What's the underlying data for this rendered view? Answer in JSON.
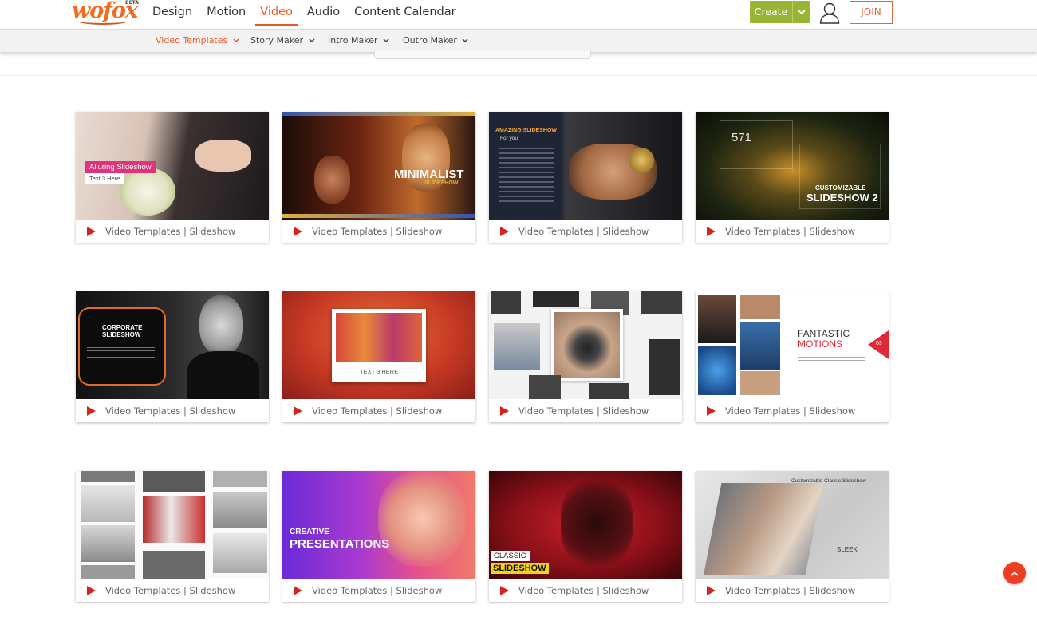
{
  "brand": {
    "logo_text": "wofox",
    "beta": "BETA"
  },
  "nav": {
    "items": [
      {
        "label": "Design",
        "active": false
      },
      {
        "label": "Motion",
        "active": false
      },
      {
        "label": "Video",
        "active": true
      },
      {
        "label": "Audio",
        "active": false
      },
      {
        "label": "Content Calendar",
        "active": false
      }
    ],
    "create_label": "Create",
    "join_label": "JOIN"
  },
  "subnav": {
    "items": [
      {
        "label": "Video Templates",
        "active": true
      },
      {
        "label": "Story Maker",
        "active": false
      },
      {
        "label": "Intro Maker",
        "active": false
      },
      {
        "label": "Outro Maker",
        "active": false
      }
    ]
  },
  "colors": {
    "accent": "#e65a26",
    "create_bg": "#99b535",
    "play_icon": "#d6231c",
    "scroll_top_bg": "#ef3d24"
  },
  "templates": [
    {
      "category": "Video Templates | Slideshow",
      "title": "Alluring Slideshow",
      "subtitle": "Text 3 Here"
    },
    {
      "category": "Video Templates | Slideshow",
      "title": "MINIMALIST",
      "subtitle": "SLIDESHOW"
    },
    {
      "category": "Video Templates | Slideshow",
      "title": "AMAZING SLIDESHOW",
      "subtitle": "For you"
    },
    {
      "category": "Video Templates | Slideshow",
      "title": "CUSTOMIZABLE",
      "subtitle": "SLIDESHOW 2",
      "extra": "571"
    },
    {
      "category": "Video Templates | Slideshow",
      "title": "CORPORATE",
      "subtitle": "SLIDESHOW"
    },
    {
      "category": "Video Templates | Slideshow",
      "title": "TEXT 3 HERE",
      "subtitle": ""
    },
    {
      "category": "Video Templates | Slideshow",
      "title": "",
      "subtitle": ""
    },
    {
      "category": "Video Templates | Slideshow",
      "title": "FANTASTIC",
      "subtitle": "MOTIONS",
      "extra": "03"
    },
    {
      "category": "Video Templates | Slideshow",
      "title": "",
      "subtitle": ""
    },
    {
      "category": "Video Templates | Slideshow",
      "title": "CREATIVE",
      "subtitle": "PRESENTATIONS"
    },
    {
      "category": "Video Templates | Slideshow",
      "title": "CLASSIC",
      "subtitle": "SLIDESHOW"
    },
    {
      "category": "Video Templates | Slideshow",
      "title": "Customizable Classic Slideshow",
      "subtitle": "SLEEK"
    }
  ]
}
